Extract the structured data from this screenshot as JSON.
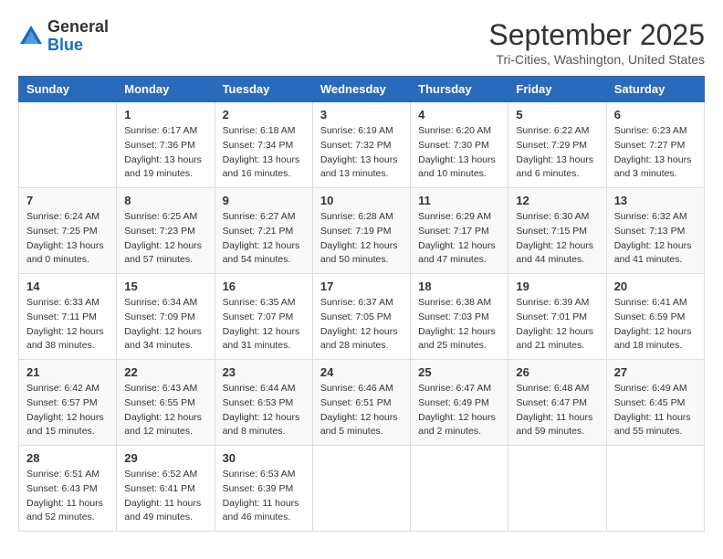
{
  "header": {
    "logo_line1": "General",
    "logo_line2": "Blue",
    "month": "September 2025",
    "location": "Tri-Cities, Washington, United States"
  },
  "weekdays": [
    "Sunday",
    "Monday",
    "Tuesday",
    "Wednesday",
    "Thursday",
    "Friday",
    "Saturday"
  ],
  "weeks": [
    [
      {
        "day": "",
        "sunrise": "",
        "sunset": "",
        "daylight": ""
      },
      {
        "day": "1",
        "sunrise": "Sunrise: 6:17 AM",
        "sunset": "Sunset: 7:36 PM",
        "daylight": "Daylight: 13 hours and 19 minutes."
      },
      {
        "day": "2",
        "sunrise": "Sunrise: 6:18 AM",
        "sunset": "Sunset: 7:34 PM",
        "daylight": "Daylight: 13 hours and 16 minutes."
      },
      {
        "day": "3",
        "sunrise": "Sunrise: 6:19 AM",
        "sunset": "Sunset: 7:32 PM",
        "daylight": "Daylight: 13 hours and 13 minutes."
      },
      {
        "day": "4",
        "sunrise": "Sunrise: 6:20 AM",
        "sunset": "Sunset: 7:30 PM",
        "daylight": "Daylight: 13 hours and 10 minutes."
      },
      {
        "day": "5",
        "sunrise": "Sunrise: 6:22 AM",
        "sunset": "Sunset: 7:29 PM",
        "daylight": "Daylight: 13 hours and 6 minutes."
      },
      {
        "day": "6",
        "sunrise": "Sunrise: 6:23 AM",
        "sunset": "Sunset: 7:27 PM",
        "daylight": "Daylight: 13 hours and 3 minutes."
      }
    ],
    [
      {
        "day": "7",
        "sunrise": "Sunrise: 6:24 AM",
        "sunset": "Sunset: 7:25 PM",
        "daylight": "Daylight: 13 hours and 0 minutes."
      },
      {
        "day": "8",
        "sunrise": "Sunrise: 6:25 AM",
        "sunset": "Sunset: 7:23 PM",
        "daylight": "Daylight: 12 hours and 57 minutes."
      },
      {
        "day": "9",
        "sunrise": "Sunrise: 6:27 AM",
        "sunset": "Sunset: 7:21 PM",
        "daylight": "Daylight: 12 hours and 54 minutes."
      },
      {
        "day": "10",
        "sunrise": "Sunrise: 6:28 AM",
        "sunset": "Sunset: 7:19 PM",
        "daylight": "Daylight: 12 hours and 50 minutes."
      },
      {
        "day": "11",
        "sunrise": "Sunrise: 6:29 AM",
        "sunset": "Sunset: 7:17 PM",
        "daylight": "Daylight: 12 hours and 47 minutes."
      },
      {
        "day": "12",
        "sunrise": "Sunrise: 6:30 AM",
        "sunset": "Sunset: 7:15 PM",
        "daylight": "Daylight: 12 hours and 44 minutes."
      },
      {
        "day": "13",
        "sunrise": "Sunrise: 6:32 AM",
        "sunset": "Sunset: 7:13 PM",
        "daylight": "Daylight: 12 hours and 41 minutes."
      }
    ],
    [
      {
        "day": "14",
        "sunrise": "Sunrise: 6:33 AM",
        "sunset": "Sunset: 7:11 PM",
        "daylight": "Daylight: 12 hours and 38 minutes."
      },
      {
        "day": "15",
        "sunrise": "Sunrise: 6:34 AM",
        "sunset": "Sunset: 7:09 PM",
        "daylight": "Daylight: 12 hours and 34 minutes."
      },
      {
        "day": "16",
        "sunrise": "Sunrise: 6:35 AM",
        "sunset": "Sunset: 7:07 PM",
        "daylight": "Daylight: 12 hours and 31 minutes."
      },
      {
        "day": "17",
        "sunrise": "Sunrise: 6:37 AM",
        "sunset": "Sunset: 7:05 PM",
        "daylight": "Daylight: 12 hours and 28 minutes."
      },
      {
        "day": "18",
        "sunrise": "Sunrise: 6:38 AM",
        "sunset": "Sunset: 7:03 PM",
        "daylight": "Daylight: 12 hours and 25 minutes."
      },
      {
        "day": "19",
        "sunrise": "Sunrise: 6:39 AM",
        "sunset": "Sunset: 7:01 PM",
        "daylight": "Daylight: 12 hours and 21 minutes."
      },
      {
        "day": "20",
        "sunrise": "Sunrise: 6:41 AM",
        "sunset": "Sunset: 6:59 PM",
        "daylight": "Daylight: 12 hours and 18 minutes."
      }
    ],
    [
      {
        "day": "21",
        "sunrise": "Sunrise: 6:42 AM",
        "sunset": "Sunset: 6:57 PM",
        "daylight": "Daylight: 12 hours and 15 minutes."
      },
      {
        "day": "22",
        "sunrise": "Sunrise: 6:43 AM",
        "sunset": "Sunset: 6:55 PM",
        "daylight": "Daylight: 12 hours and 12 minutes."
      },
      {
        "day": "23",
        "sunrise": "Sunrise: 6:44 AM",
        "sunset": "Sunset: 6:53 PM",
        "daylight": "Daylight: 12 hours and 8 minutes."
      },
      {
        "day": "24",
        "sunrise": "Sunrise: 6:46 AM",
        "sunset": "Sunset: 6:51 PM",
        "daylight": "Daylight: 12 hours and 5 minutes."
      },
      {
        "day": "25",
        "sunrise": "Sunrise: 6:47 AM",
        "sunset": "Sunset: 6:49 PM",
        "daylight": "Daylight: 12 hours and 2 minutes."
      },
      {
        "day": "26",
        "sunrise": "Sunrise: 6:48 AM",
        "sunset": "Sunset: 6:47 PM",
        "daylight": "Daylight: 11 hours and 59 minutes."
      },
      {
        "day": "27",
        "sunrise": "Sunrise: 6:49 AM",
        "sunset": "Sunset: 6:45 PM",
        "daylight": "Daylight: 11 hours and 55 minutes."
      }
    ],
    [
      {
        "day": "28",
        "sunrise": "Sunrise: 6:51 AM",
        "sunset": "Sunset: 6:43 PM",
        "daylight": "Daylight: 11 hours and 52 minutes."
      },
      {
        "day": "29",
        "sunrise": "Sunrise: 6:52 AM",
        "sunset": "Sunset: 6:41 PM",
        "daylight": "Daylight: 11 hours and 49 minutes."
      },
      {
        "day": "30",
        "sunrise": "Sunrise: 6:53 AM",
        "sunset": "Sunset: 6:39 PM",
        "daylight": "Daylight: 11 hours and 46 minutes."
      },
      {
        "day": "",
        "sunrise": "",
        "sunset": "",
        "daylight": ""
      },
      {
        "day": "",
        "sunrise": "",
        "sunset": "",
        "daylight": ""
      },
      {
        "day": "",
        "sunrise": "",
        "sunset": "",
        "daylight": ""
      },
      {
        "day": "",
        "sunrise": "",
        "sunset": "",
        "daylight": ""
      }
    ]
  ]
}
